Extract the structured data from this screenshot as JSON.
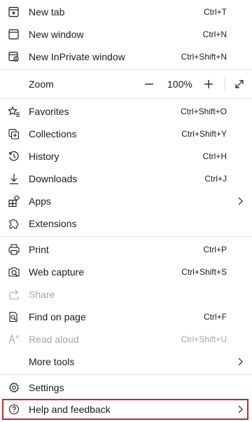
{
  "items": {
    "new_tab": {
      "label": "New tab",
      "shortcut": "Ctrl+T",
      "icon": "new-tab-icon"
    },
    "new_window": {
      "label": "New window",
      "shortcut": "Ctrl+N",
      "icon": "new-window-icon"
    },
    "new_inprivate": {
      "label": "New InPrivate window",
      "shortcut": "Ctrl+Shift+N",
      "icon": "inprivate-icon"
    },
    "zoom": {
      "label": "Zoom",
      "value": "100%",
      "icon_minus": "minus-icon",
      "icon_plus": "plus-icon",
      "icon_fullscreen": "fullscreen-icon"
    },
    "favorites": {
      "label": "Favorites",
      "shortcut": "Ctrl+Shift+O",
      "icon": "star-list-icon"
    },
    "collections": {
      "label": "Collections",
      "shortcut": "Ctrl+Shift+Y",
      "icon": "collections-icon"
    },
    "history": {
      "label": "History",
      "shortcut": "Ctrl+H",
      "icon": "history-icon"
    },
    "downloads": {
      "label": "Downloads",
      "shortcut": "Ctrl+J",
      "icon": "download-icon"
    },
    "apps": {
      "label": "Apps",
      "icon": "apps-icon"
    },
    "extensions": {
      "label": "Extensions",
      "icon": "puzzle-icon"
    },
    "print": {
      "label": "Print",
      "shortcut": "Ctrl+P",
      "icon": "printer-icon"
    },
    "web_capture": {
      "label": "Web capture",
      "shortcut": "Ctrl+Shift+S",
      "icon": "capture-icon"
    },
    "share": {
      "label": "Share",
      "icon": "share-icon",
      "disabled": true
    },
    "find": {
      "label": "Find on page",
      "shortcut": "Ctrl+F",
      "icon": "find-icon"
    },
    "read_aloud": {
      "label": "Read aloud",
      "shortcut": "Ctrl+Shift+U",
      "icon": "read-aloud-icon",
      "disabled": true
    },
    "more_tools": {
      "label": "More tools"
    },
    "settings": {
      "label": "Settings",
      "icon": "gear-icon"
    },
    "help": {
      "label": "Help and feedback",
      "icon": "help-icon"
    }
  },
  "colors": {
    "text": "#1b1b1b",
    "disabled": "#a6a6a6",
    "divider": "#e3e3e3",
    "highlight": "#c4282f"
  }
}
